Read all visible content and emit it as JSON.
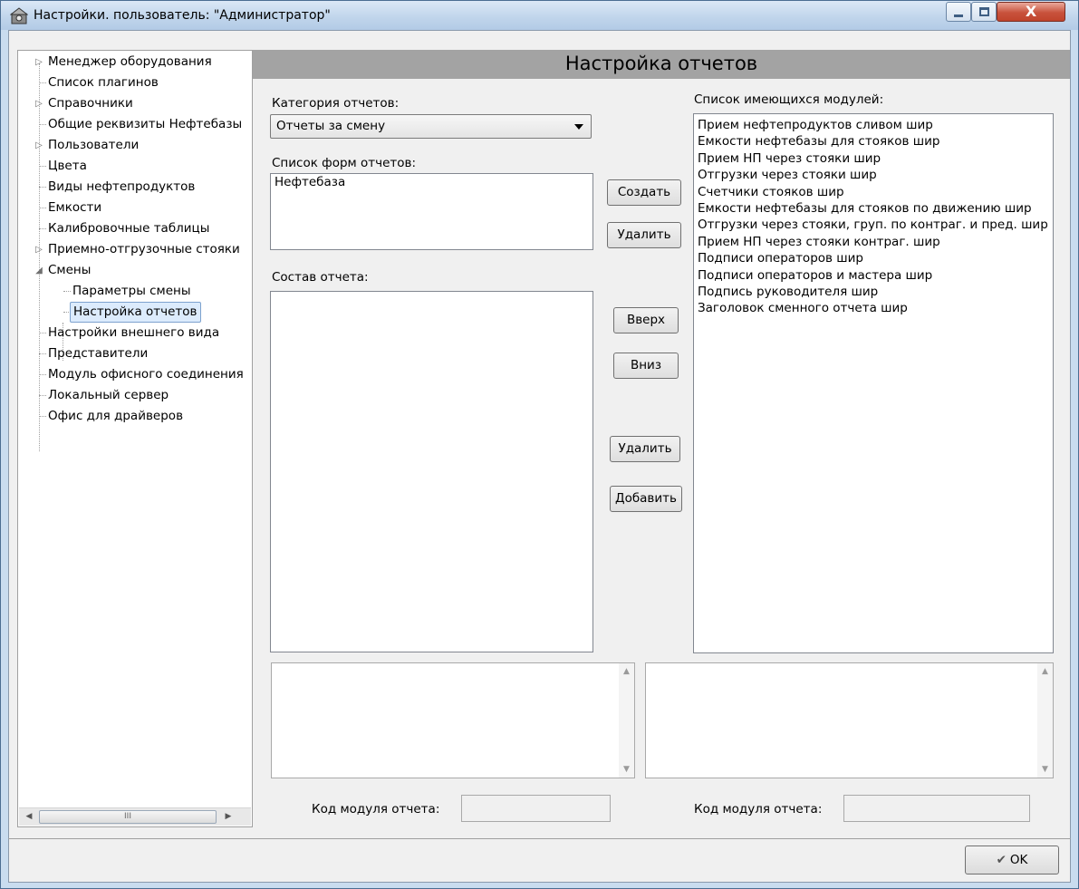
{
  "window": {
    "title": "Настройки. пользователь: \"Администратор\"",
    "close_glyph": "X"
  },
  "tree": {
    "items": [
      {
        "label": "Менеджер оборудования",
        "expandable": true
      },
      {
        "label": "Список плагинов",
        "expandable": false
      },
      {
        "label": "Справочники",
        "expandable": true
      },
      {
        "label": "Общие реквизиты Нефтебазы",
        "expandable": false
      },
      {
        "label": "Пользователи",
        "expandable": true
      },
      {
        "label": "Цвета",
        "expandable": false
      },
      {
        "label": "Виды нефтепродуктов",
        "expandable": false
      },
      {
        "label": "Емкости",
        "expandable": false
      },
      {
        "label": "Калибровочные таблицы",
        "expandable": false
      },
      {
        "label": "Приемно-отгрузочные стояки",
        "expandable": true
      },
      {
        "label": "Смены",
        "expanded": true
      },
      {
        "label": "Параметры смены",
        "child": true
      },
      {
        "label": "Настройка отчетов",
        "child": true,
        "selected": true
      },
      {
        "label": "Настройки внешнего вида",
        "expandable": false
      },
      {
        "label": "Представители",
        "expandable": false
      },
      {
        "label": "Модуль офисного соединения",
        "expandable": false
      },
      {
        "label": "Локальный сервер",
        "expandable": false
      },
      {
        "label": "Офис для драйверов",
        "expandable": false
      }
    ],
    "scroll_grip": "III"
  },
  "panel": {
    "header": "Настройка отчетов",
    "category_label": "Категория отчетов:",
    "category_value": "Отчеты за смену",
    "forms_label": "Список форм отчетов:",
    "forms": [
      "Нефтебаза"
    ],
    "composition_label": "Состав отчета:",
    "composition": [],
    "modules_label": "Список имеющихся модулей:",
    "modules": [
      "Прием нефтепродуктов сливом шир",
      "Емкости нефтебазы для стояков шир",
      "Прием НП через стояки шир",
      "Отгрузки через стояки шир",
      "Счетчики стояков шир",
      "Емкости нефтебазы для стояков по движению шир",
      "Отгрузки через стояки, груп. по контраг. и пред. шир",
      "Прием НП через стояки контраг. шир",
      "Подписи операторов шир",
      "Подписи операторов и мастера шир",
      "Подпись руководителя шир",
      "Заголовок сменного отчета  шир"
    ],
    "buttons": {
      "create": "Создать",
      "delete_form": "Удалить",
      "up": "Вверх",
      "down": "Вниз",
      "delete_item": "Удалить",
      "add": "Добавить"
    },
    "code_label_left": "Код модуля отчета:",
    "code_label_right": "Код модуля отчета:",
    "code_value_left": "",
    "code_value_right": ""
  },
  "footer": {
    "ok": "OK"
  },
  "colors": {
    "header_bg": "#a3a3a3",
    "selection": "#dcebfc",
    "close_button": "#c8523c"
  }
}
